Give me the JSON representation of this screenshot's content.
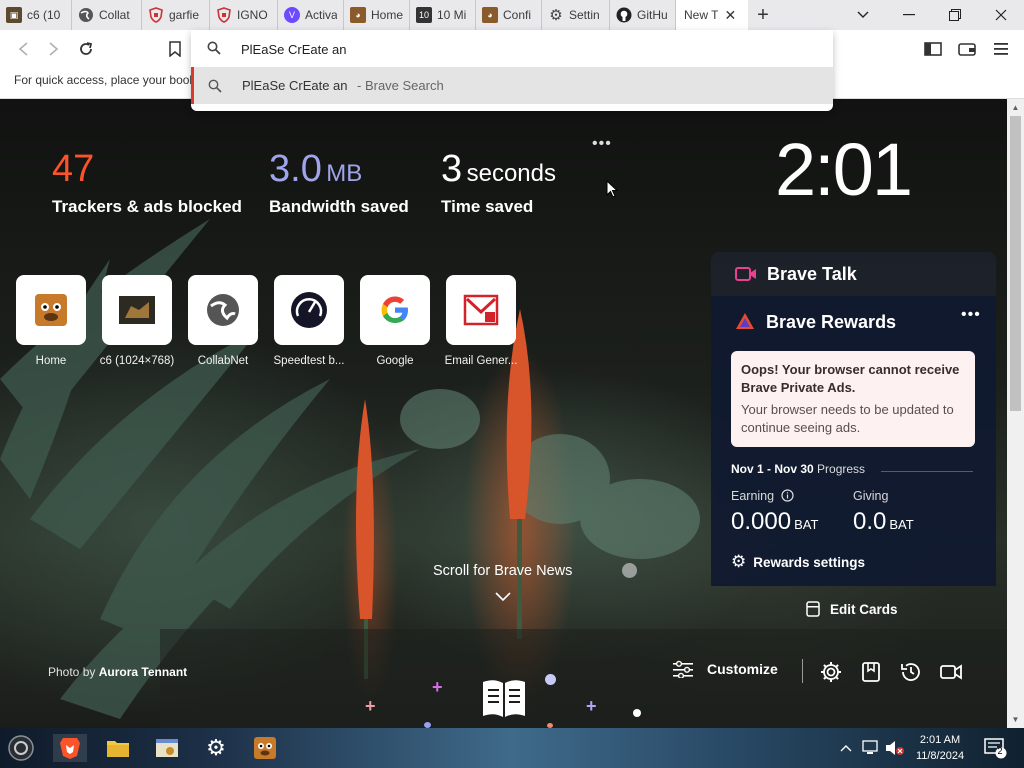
{
  "tabs": [
    {
      "label": "c6 (10",
      "icon": "image-thumbnail-icon"
    },
    {
      "label": "Collat",
      "icon": "globe-icon"
    },
    {
      "label": "garfie",
      "icon": "shield-icon"
    },
    {
      "label": "IGNO",
      "icon": "shield-icon"
    },
    {
      "label": "Activa",
      "icon": "proton-icon"
    },
    {
      "label": "Home",
      "icon": "dog-icon"
    },
    {
      "label": "10 Mi",
      "icon": "number-icon"
    },
    {
      "label": "Confi",
      "icon": "dog-icon"
    },
    {
      "label": "Settin",
      "icon": "gear-icon"
    },
    {
      "label": "GitHu",
      "icon": "github-icon"
    },
    {
      "label": "New T",
      "icon": "",
      "active": true
    }
  ],
  "toolbar": {
    "bookmarks_hint": "For quick access, place your book"
  },
  "omnibox": {
    "value": "PlEaSe CrEate an",
    "suggestion_query": "PlEaSe CrEate an",
    "suggestion_suffix": " - Brave Search"
  },
  "stats": [
    {
      "value": "47",
      "unit": "",
      "label": "Trackers & ads blocked",
      "color": "#fb542b"
    },
    {
      "value": "3.0",
      "unit": "MB",
      "label": "Bandwidth saved",
      "color": "#a0a5eb"
    },
    {
      "value": "3",
      "unit": "seconds",
      "label": "Time saved",
      "color": "#ffffff"
    }
  ],
  "clock": "2:01",
  "top_sites": [
    {
      "name": "Home",
      "icon": "dog-icon"
    },
    {
      "name": "c6 (1024×768)",
      "icon": "image-thumbnail-icon"
    },
    {
      "name": "CollabNet",
      "icon": "globe-icon"
    },
    {
      "name": "Speedtest b...",
      "icon": "speedometer-icon"
    },
    {
      "name": "Google",
      "icon": "google-icon"
    },
    {
      "name": "Email Gener...",
      "icon": "email-icon"
    }
  ],
  "brave_talk": {
    "title": "Brave Talk"
  },
  "rewards": {
    "title": "Brave Rewards",
    "notice_title": "Oops! Your browser cannot receive Brave Private Ads.",
    "notice_body": "Your browser needs to be updated to continue seeing ads.",
    "period": "Nov 1 - Nov 30",
    "period_suffix": " Progress",
    "earning_label": "Earning",
    "earning_value": "0.000",
    "giving_label": "Giving",
    "giving_value": "0.0",
    "currency": "BAT",
    "settings_label": "Rewards settings"
  },
  "edit_cards": "Edit Cards",
  "scroll_news": "Scroll for Brave News",
  "photo_credit": {
    "prefix": "Photo by ",
    "author": "Aurora Tennant"
  },
  "customize": "Customize",
  "taskbar": {
    "time": "2:01 AM",
    "date": "11/8/2024",
    "notifications": "2"
  }
}
